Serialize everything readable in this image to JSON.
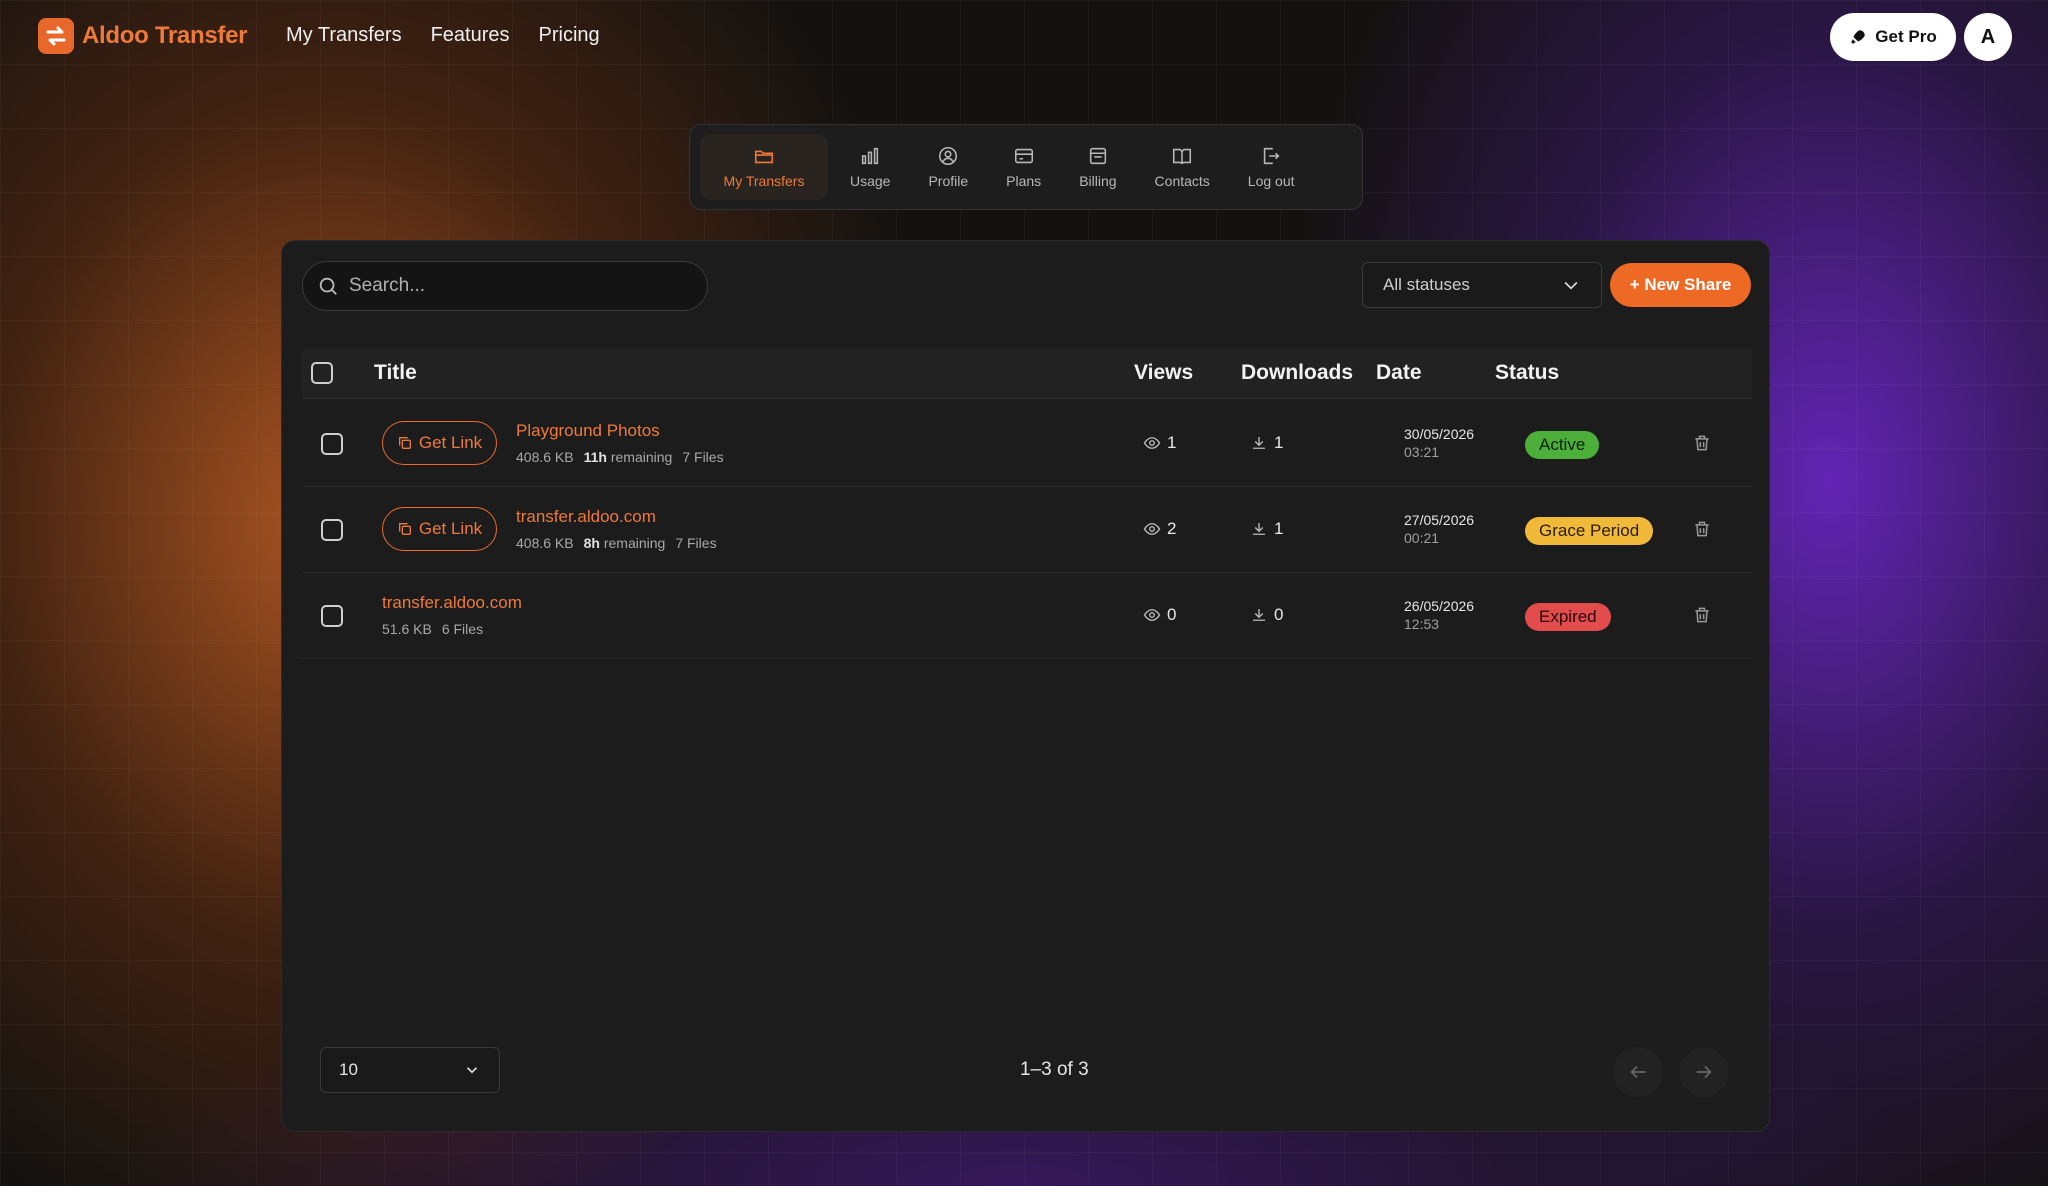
{
  "brand": {
    "name": "Aldoo Transfer"
  },
  "topnav": [
    "My Transfers",
    "Features",
    "Pricing"
  ],
  "header": {
    "get_pro": "Get Pro",
    "avatar_initial": "A"
  },
  "account_tabs": [
    {
      "label": "My Transfers",
      "icon": "folder-icon",
      "active": true
    },
    {
      "label": "Usage",
      "icon": "bar-chart-icon",
      "active": false
    },
    {
      "label": "Profile",
      "icon": "user-circle-icon",
      "active": false
    },
    {
      "label": "Plans",
      "icon": "card-icon",
      "active": false
    },
    {
      "label": "Billing",
      "icon": "receipt-icon",
      "active": false
    },
    {
      "label": "Contacts",
      "icon": "book-icon",
      "active": false
    },
    {
      "label": "Log out",
      "icon": "logout-icon",
      "active": false
    }
  ],
  "toolbar": {
    "search_placeholder": "Search...",
    "status_filter": "All statuses",
    "new_share": "+ New Share"
  },
  "table": {
    "headers": {
      "title": "Title",
      "views": "Views",
      "downloads": "Downloads",
      "date": "Date",
      "status": "Status"
    },
    "get_link": "Get Link",
    "rows": [
      {
        "title": "Playground Photos",
        "size": "408.6 KB",
        "remaining_value": "11h",
        "remaining_label": "remaining",
        "files": "7 Files",
        "views": "1",
        "downloads": "1",
        "date": "30/05/2026",
        "time": "03:21",
        "status": "Active",
        "has_link": true
      },
      {
        "title": "transfer.aldoo.com",
        "size": "408.6 KB",
        "remaining_value": "8h",
        "remaining_label": "remaining",
        "files": "7 Files",
        "views": "2",
        "downloads": "1",
        "date": "27/05/2026",
        "time": "00:21",
        "status": "Grace Period",
        "has_link": true
      },
      {
        "title": "transfer.aldoo.com",
        "size": "51.6 KB",
        "files": "6 Files",
        "views": "0",
        "downloads": "0",
        "date": "26/05/2026",
        "time": "12:53",
        "status": "Expired",
        "has_link": false
      }
    ]
  },
  "status_colors": {
    "Active": "#4caf3a",
    "Grace Period": "#f0b93a",
    "Expired": "#e24c4c"
  },
  "pagination": {
    "page_size": "10",
    "range": "1–3 of 3"
  },
  "colors": {
    "accent": "#ee6a24",
    "panel": "#1c1c1c"
  }
}
